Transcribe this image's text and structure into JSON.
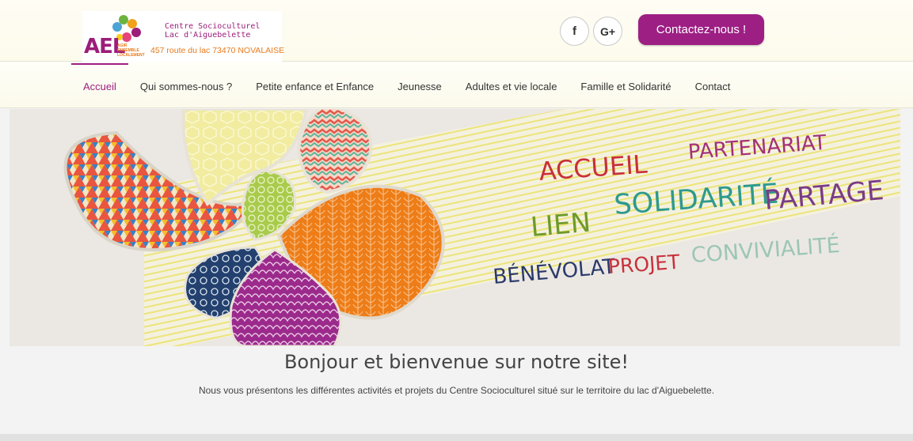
{
  "logo": {
    "short": "AEL",
    "tagline": "AGIR ENSEMBLE LOCALEMENT",
    "name_line1": "Centre Socioculturel",
    "name_line2": "Lac d'Aiguebelette",
    "address": "457 route du lac 73470 NOVALAISE"
  },
  "social": {
    "facebook_glyph": "f",
    "googleplus_glyph": "G+"
  },
  "header": {
    "contact_label": "Contactez-nous !"
  },
  "nav": {
    "items": [
      {
        "label": "Accueil",
        "active": true
      },
      {
        "label": "Qui sommes-nous ?"
      },
      {
        "label": "Petite enfance et Enfance"
      },
      {
        "label": "Jeunesse"
      },
      {
        "label": "Adultes et vie locale"
      },
      {
        "label": "Famille et Solidarité"
      },
      {
        "label": "Contact"
      }
    ]
  },
  "banner": {
    "words": {
      "accueil": "ACCUEIL",
      "partenariat": "PARTENARIAT",
      "lien": "LIEN",
      "solidarite": "SOLIDARITÉ",
      "partage": "PARTAGE",
      "benevolat": "BÉNÉVOLAT",
      "projet": "PROJET",
      "convivialite": "CONVIVIALITÉ"
    },
    "colors": {
      "red": "#c8303a",
      "magenta": "#a3307a",
      "green": "#6f9a2a",
      "teal": "#2e9a8e",
      "purple": "#7a3c86",
      "navy": "#2b3a6b",
      "mint": "#9cc6b6",
      "orange": "#ef7f1a"
    }
  },
  "content": {
    "welcome_title": "Bonjour et bienvenue sur notre site!",
    "intro_text": "Nous vous présentons les différentes activités et projets du Centre Socioculturel situé sur le territoire du lac d'Aiguebelette."
  }
}
